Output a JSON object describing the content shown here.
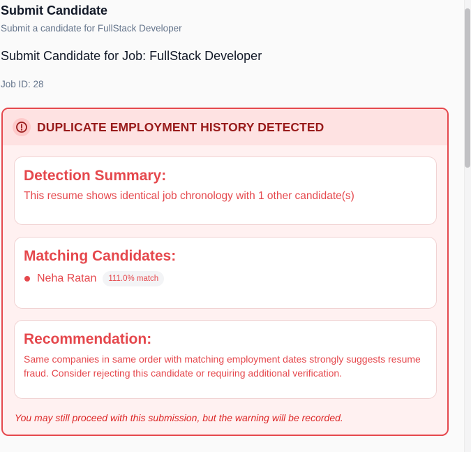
{
  "header": {
    "title": "Submit Candidate",
    "subtitle": "Submit a candidate for FullStack Developer"
  },
  "job": {
    "heading": "Submit Candidate for Job: FullStack Developer",
    "id_text": "Job ID: 28"
  },
  "alert": {
    "title": "DUPLICATE EMPLOYMENT HISTORY DETECTED",
    "icon": "alert-circle-icon",
    "colors": {
      "border": "#e5484d",
      "title": "#991b1b",
      "text": "#e5484d",
      "background": "#fff1f1"
    },
    "summary": {
      "heading": "Detection Summary:",
      "text": "This resume shows identical job chronology with 1 other candidate(s)"
    },
    "matching": {
      "heading": "Matching Candidates:",
      "candidates": [
        {
          "name": "Neha Ratan",
          "match": "111.0% match"
        }
      ]
    },
    "recommendation": {
      "heading": "Recommendation:",
      "text": "Same companies in same order with matching employment dates strongly suggests resume fraud. Consider rejecting this candidate or requiring additional verification."
    },
    "footnote": "You may still proceed with this submission, but the warning will be recorded."
  }
}
